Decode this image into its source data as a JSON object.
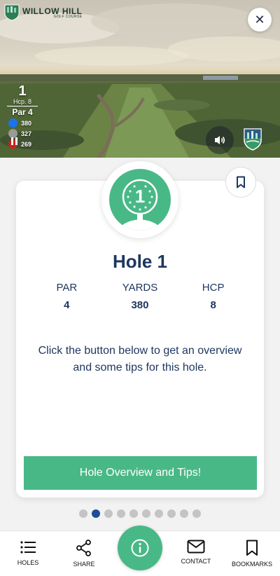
{
  "header": {
    "logo_name": "WILLOW HILL",
    "logo_sub": "GOLF COURSE"
  },
  "video": {
    "hole_number": "1",
    "hcp_text": "Hcp. 8",
    "par_text": "Par 4",
    "tees": [
      {
        "color": "#1a73e8",
        "yards": "380"
      },
      {
        "color": "#9a9a9a",
        "yards": "327"
      },
      {
        "color": "#cc1f1f",
        "yards": "269"
      }
    ]
  },
  "card": {
    "badge_number": "1",
    "title": "Hole 1",
    "stats": [
      {
        "label": "PAR",
        "value": "4"
      },
      {
        "label": "YARDS",
        "value": "380"
      },
      {
        "label": "HCP",
        "value": "8"
      }
    ],
    "description": "Click the button below to get an overview and some tips for this hole.",
    "cta_label": "Hole Overview and Tips!"
  },
  "pager": {
    "total": 10,
    "active_index": 1
  },
  "nav": {
    "holes": "HOLES",
    "share": "SHARE",
    "contact": "CONTACT",
    "bookmarks": "BOOKMARKS"
  },
  "colors": {
    "accent": "#49b887",
    "heading": "#1e3760",
    "pager_active": "#1e4f94"
  }
}
